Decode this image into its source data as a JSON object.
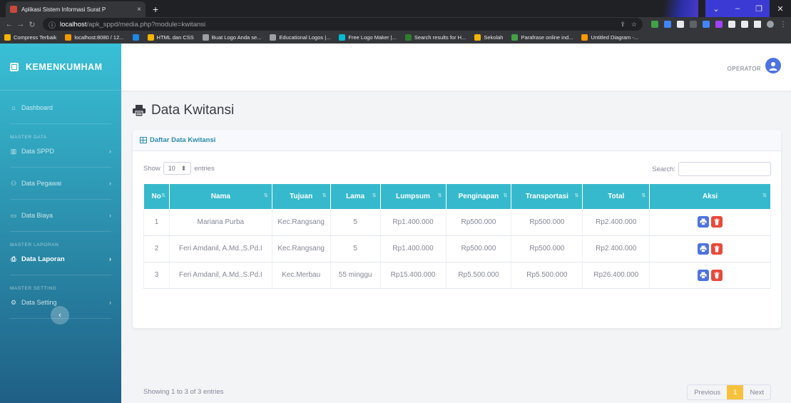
{
  "browser": {
    "tab_title": "Aplikasi Sistem Informasi Surat P",
    "tab_close": "×",
    "new_tab": "+",
    "url_host": "localhost",
    "url_path": "/apk_sppd/media.php?module=kwitansi",
    "bookmarks": [
      {
        "label": "Compress Terbaik",
        "color": "#f4b400"
      },
      {
        "label": "localhost:8080 / 12...",
        "color": "#f29900"
      },
      {
        "label": "",
        "color": "#1e88e5"
      },
      {
        "label": "HTML dan CSS",
        "color": "#f4b400"
      },
      {
        "label": "Buat Logo Anda se...",
        "color": "#9aa0a6"
      },
      {
        "label": "Educational Logos |...",
        "color": "#9aa0a6"
      },
      {
        "label": "Free Logo Maker |...",
        "color": "#00bcd4"
      },
      {
        "label": "Search results for H...",
        "color": "#2e7d32"
      },
      {
        "label": "Sekolah",
        "color": "#f4b400"
      },
      {
        "label": "Parafrase online ind...",
        "color": "#43a047"
      },
      {
        "label": "Untitled Diagram -...",
        "color": "#ff9800"
      }
    ]
  },
  "sidebar": {
    "brand": "KEMENKUMHAM",
    "dashboard": "Dashboard",
    "section_master_data": "MASTER DATA",
    "data_sppd": "Data SPPD",
    "data_pegawai": "Data Pegawai",
    "data_biaya": "Data Biaya",
    "section_master_laporan": "MASTER LAPORAN",
    "data_laporan": "Data Laporan",
    "section_master_setting": "MASTER SETTING",
    "data_setting": "Data Setting"
  },
  "topbar": {
    "user_role": "OPERATOR"
  },
  "page": {
    "title": "Data Kwitansi",
    "card_title": "Daftar Data Kwitansi",
    "show_label": "Show",
    "show_value": "10",
    "entries_label": "entries",
    "search_label": "Search:",
    "search_value": "",
    "info": "Showing 1 to 3 of 3 entries",
    "prev": "Previous",
    "current_page": "1",
    "next": "Next"
  },
  "table": {
    "headers": [
      "No",
      "Nama",
      "Tujuan",
      "Lama",
      "Lumpsum",
      "Penginapan",
      "Transportasi",
      "Total",
      "Aksi"
    ],
    "rows": [
      [
        "1",
        "Mariana Purba",
        "Kec.Rangsang",
        "5",
        "Rp1.400.000",
        "Rp500.000",
        "Rp500.000",
        "Rp2.400.000"
      ],
      [
        "2",
        "Feri Amdanil, A.Md.,S.Pd.I",
        "Kec.Rangsang",
        "5",
        "Rp1.400.000",
        "Rp500.000",
        "Rp500.000",
        "Rp2.400.000"
      ],
      [
        "3",
        "Feri Amdanil, A.Md.,S.Pd.I",
        "Kec.Merbau",
        "55 minggu",
        "Rp15.400.000",
        "Rp5.500.000",
        "Rp5.500.000",
        "Rp26.400.000"
      ]
    ]
  },
  "colors": {
    "accent": "#36b9cc",
    "print_button": "#4e73df",
    "delete_button": "#e74a3b",
    "pager_active": "#f6c23e"
  }
}
